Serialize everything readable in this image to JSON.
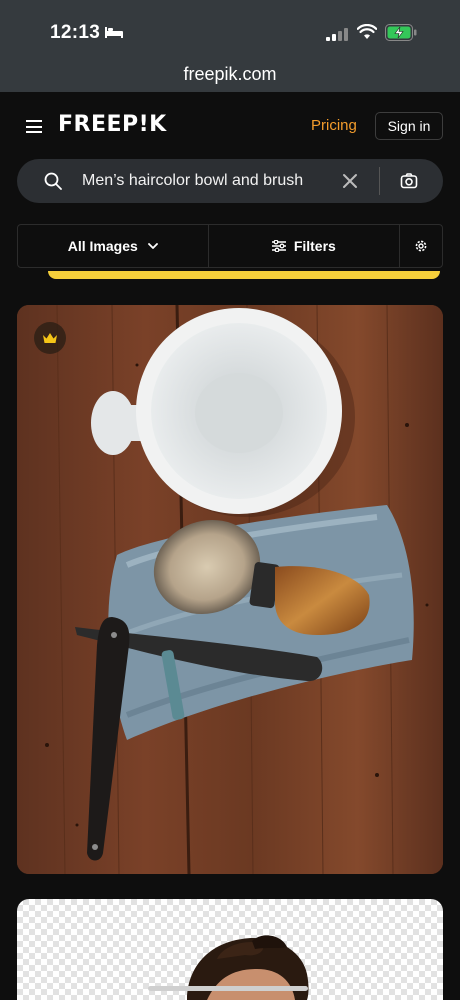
{
  "status_bar": {
    "time": "12:13"
  },
  "browser": {
    "url": "freepik.com"
  },
  "header": {
    "logo": "FREEP!K",
    "pricing_label": "Pricing",
    "signin_label": "Sign in"
  },
  "search": {
    "query": "Men’s haircolor bowl and brush"
  },
  "filters": {
    "type_label": "All Images",
    "filters_label": "Filters"
  },
  "colors": {
    "accent": "#f39c2c",
    "premium_badge": "#f5c518",
    "strip": "#f5cf3b"
  },
  "results": [
    {
      "type": "photo",
      "premium": true,
      "icon": "crown-icon"
    },
    {
      "type": "transparent-png",
      "premium": false
    }
  ]
}
